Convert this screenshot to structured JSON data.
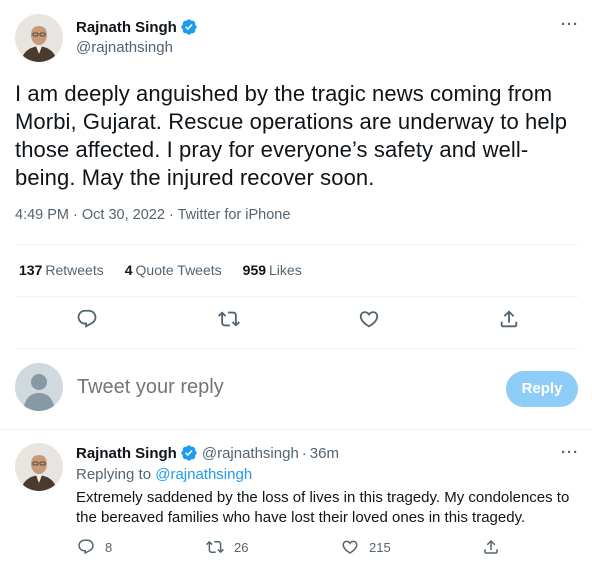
{
  "main_tweet": {
    "author_name": "Rajnath Singh",
    "handle": "@rajnathsingh",
    "text": "I am deeply anguished by the tragic news coming from Morbi, Gujarat. Rescue operations are underway to help those affected. I pray for everyone’s safety and well-being. May the injured recover soon.",
    "time": "4:49 PM",
    "date": "Oct 30, 2022",
    "source": "Twitter for iPhone",
    "separator": "·",
    "stats": {
      "retweets_count": "137",
      "retweets_label": "Retweets",
      "quotes_count": "4",
      "quotes_label": "Quote Tweets",
      "likes_count": "959",
      "likes_label": "Likes"
    },
    "more_label": "···"
  },
  "reply_composer": {
    "placeholder": "Tweet your reply",
    "button_label": "Reply"
  },
  "reply_tweet": {
    "author_name": "Rajnath Singh",
    "handle": "@rajnathsingh",
    "separator": "·",
    "time": "36m",
    "replying_prefix": "Replying to",
    "replying_handle": "@rajnathsingh",
    "text": "Extremely saddened by the loss of lives in this tragedy. My condolences to the bereaved families who have lost their loved ones in this tragedy.",
    "reply_count": "8",
    "retweet_count": "26",
    "like_count": "215",
    "more_label": "···"
  },
  "icons": {
    "verified": "verified-badge-icon",
    "reply": "reply-icon",
    "retweet": "retweet-icon",
    "like": "heart-icon",
    "share": "share-icon",
    "more": "more-icon"
  },
  "colors": {
    "accent": "#1d9bf0",
    "reply_button_disabled": "#8ecdf8",
    "secondary_text": "#536471",
    "primary_text": "#0f1419",
    "divider": "#eff3f4"
  }
}
